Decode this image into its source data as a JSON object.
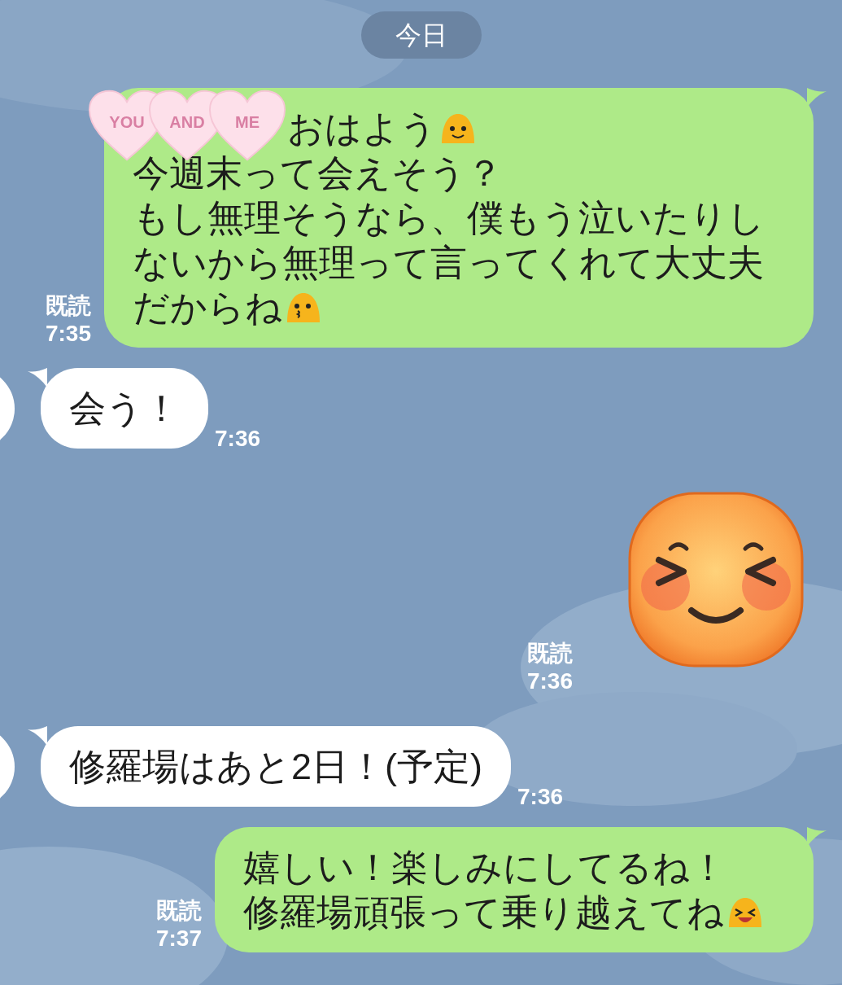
{
  "date_label": "今日",
  "messages": [
    {
      "kind": "sent-text",
      "read": "既読",
      "time": "7:35",
      "overlay_sticker": {
        "words": [
          "YOU",
          "AND",
          "ME"
        ]
      },
      "lines": [
        [
          {
            "kind": "text",
            "text": "おはよう"
          },
          {
            "kind": "smile-emoji"
          }
        ],
        [
          {
            "kind": "text",
            "text": "今週末って会えそう？"
          }
        ],
        [
          {
            "kind": "text",
            "text": "もし無理そうなら、僕もう泣いたりし"
          }
        ],
        [
          {
            "kind": "text",
            "text": "ないから無理って言ってくれて大丈夫"
          }
        ],
        [
          {
            "kind": "text",
            "text": "だからね"
          },
          {
            "kind": "kiss-emoji"
          }
        ]
      ]
    },
    {
      "kind": "received-text",
      "time": "7:36",
      "lines": [
        [
          {
            "kind": "text",
            "text": "会う！"
          }
        ]
      ]
    },
    {
      "kind": "sent-sticker",
      "read": "既読",
      "time": "7:36"
    },
    {
      "kind": "received-text",
      "time": "7:36",
      "lines": [
        [
          {
            "kind": "text",
            "text": "修羅場はあと2日！(予定)"
          }
        ]
      ]
    },
    {
      "kind": "sent-text",
      "read": "既読",
      "time": "7:37",
      "lines": [
        [
          {
            "kind": "text",
            "text": "嬉しい！楽しみにしてるね！"
          }
        ],
        [
          {
            "kind": "text",
            "text": "修羅場頑張って乗り越えてね"
          },
          {
            "kind": "laugh-emoji"
          }
        ]
      ]
    }
  ]
}
